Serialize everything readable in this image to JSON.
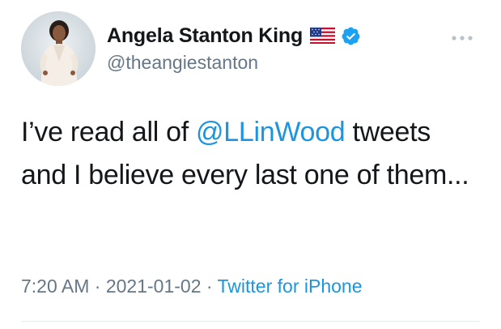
{
  "author": {
    "display_name": "Angela Stanton King",
    "handle": "@theangiestanton",
    "verified": true
  },
  "tweet": {
    "text_before": "I’ve read all of ",
    "mention": "@LLinWood",
    "text_after": " tweets and I believe every last one of them..."
  },
  "meta": {
    "time": "7:20 AM",
    "date": "2021-01-02",
    "separator": " · ",
    "source": "Twitter for iPhone"
  },
  "icons": {
    "flag": "us-flag-icon",
    "verified": "verified-badge-icon",
    "more": "more-options-icon"
  },
  "colors": {
    "accent": "#1b95e0",
    "text": "#14171a",
    "secondary": "#657786"
  }
}
